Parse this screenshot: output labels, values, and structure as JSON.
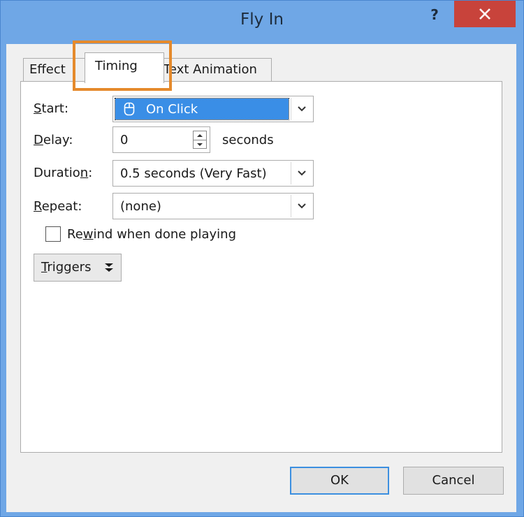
{
  "window": {
    "title": "Fly In",
    "help_label": "?"
  },
  "tabs": [
    {
      "label": "Effect"
    },
    {
      "label": "Timing"
    },
    {
      "label": "Text Animation"
    }
  ],
  "timing": {
    "start": {
      "label_u": "S",
      "label_rest": "tart:",
      "value": "On Click"
    },
    "delay": {
      "label_u": "D",
      "label_rest": "elay:",
      "value": "0",
      "unit": "seconds"
    },
    "duration": {
      "label_pre": "Duratio",
      "label_u": "n",
      "label_rest": ":",
      "value": "0.5 seconds (Very Fast)"
    },
    "repeat": {
      "label_u": "R",
      "label_rest": "epeat:",
      "value": "(none)"
    },
    "rewind": {
      "label_pre": "Re",
      "label_u": "w",
      "label_rest": "ind when done playing",
      "checked": false
    },
    "triggers": {
      "label_u": "T",
      "label_rest": "riggers"
    }
  },
  "buttons": {
    "ok": "OK",
    "cancel": "Cancel"
  },
  "colors": {
    "title_bar": "#6fa7e6",
    "close": "#c8433b",
    "selection": "#3a8ee6",
    "highlight": "#e58a2c"
  }
}
